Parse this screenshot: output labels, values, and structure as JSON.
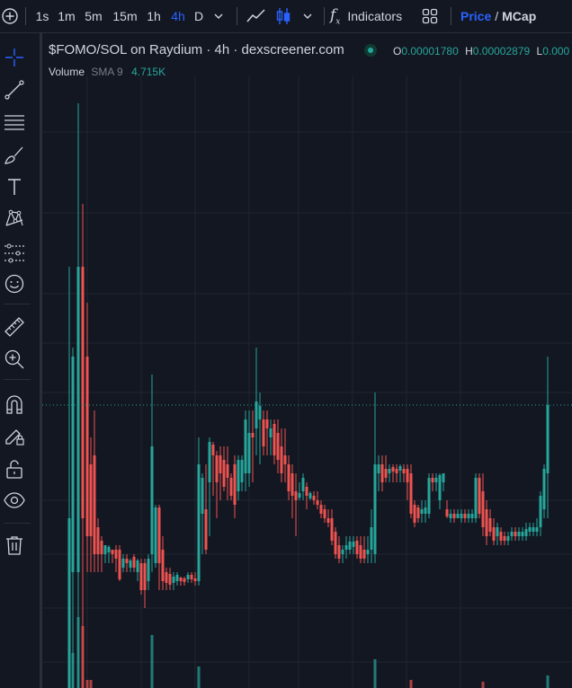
{
  "toolbar": {
    "timeframes": [
      "1s",
      "1m",
      "5m",
      "15m",
      "1h",
      "4h",
      "D"
    ],
    "active_timeframe": "4h",
    "indicators_label": "Indicators",
    "price_label": "Price",
    "separator": "/",
    "mcap_label": "MCap",
    "accent_color": "#2962ff"
  },
  "sidebar": {
    "tools": [
      "crosshair-icon",
      "trend-line-icon",
      "fib-retracement-icon",
      "brush-icon",
      "text-icon",
      "pattern-icon",
      "prediction-icon",
      "emoji-icon",
      "ruler-icon",
      "zoom-in-icon",
      "magnet-icon",
      "lock-drawing-icon",
      "unlock-icon",
      "eye-icon",
      "trash-icon"
    ]
  },
  "chart": {
    "title": "$FOMO/SOL on Raydium · 4h · dexscreener.com",
    "open_key": "O",
    "open_value": "0.00001780",
    "high_key": "H",
    "high_value": "0.00002879",
    "low_key": "L",
    "low_value": "0.000",
    "volume_label": "Volume",
    "volume_sma_label": "SMA 9",
    "volume_value": "4.715K",
    "up_color": "#26a69a",
    "down_color": "#ef5350"
  }
}
